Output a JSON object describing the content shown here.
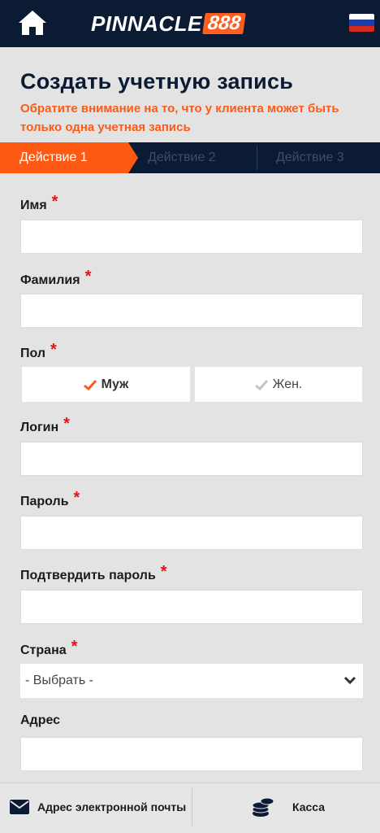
{
  "header": {
    "logo_text": "PINNACLE",
    "logo_number": "888",
    "home_icon": "home-icon",
    "language_flag": "russia-flag-icon"
  },
  "page": {
    "title": "Создать учетную запись",
    "notice": "Обратите внимание на то, что у клиента может быть только одна учетная запись"
  },
  "steps": [
    {
      "label": "Действие 1",
      "active": true
    },
    {
      "label": "Действие 2",
      "active": false
    },
    {
      "label": "Действие 3",
      "active": false
    }
  ],
  "form": {
    "required_mark": "*",
    "first_name": {
      "label": "Имя",
      "value": ""
    },
    "last_name": {
      "label": "Фамилия",
      "value": ""
    },
    "gender": {
      "label": "Пол",
      "male": "Муж",
      "female": "Жен.",
      "selected": "male"
    },
    "login": {
      "label": "Логин",
      "value": ""
    },
    "password": {
      "label": "Пароль",
      "value": ""
    },
    "confirm_password": {
      "label": "Подтвердить пароль",
      "value": ""
    },
    "country": {
      "label": "Страна",
      "selected": "- Выбрать -"
    },
    "address": {
      "label": "Адрес",
      "value": ""
    }
  },
  "footer": {
    "email_label": "Адрес электронной почты",
    "cashier_label": "Касса"
  },
  "colors": {
    "navy": "#0b1b33",
    "accent": "#ff5a14",
    "required": "#e8101a",
    "background": "#e3e3e3"
  }
}
